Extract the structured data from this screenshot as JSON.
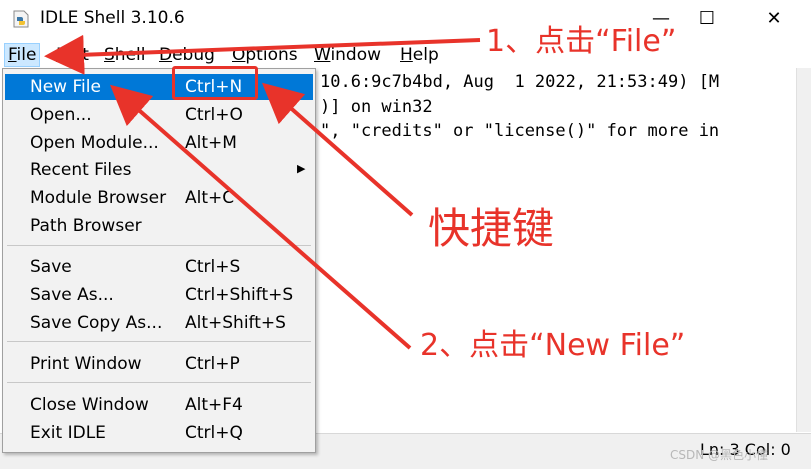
{
  "window": {
    "title": "IDLE Shell 3.10.6",
    "icon": "python-icon",
    "controls": {
      "minimize": "—",
      "maximize": "☐",
      "close": "✕"
    }
  },
  "menubar": {
    "items": [
      {
        "id": "file",
        "label": "File",
        "underline": "F",
        "rest": "ile"
      },
      {
        "id": "edit",
        "label": "Edit",
        "underline": "E",
        "rest": "dit"
      },
      {
        "id": "shell",
        "label": "Shell",
        "underline": "S",
        "rest": "hell"
      },
      {
        "id": "debug",
        "label": "Debug",
        "underline": "D",
        "rest": "ebug"
      },
      {
        "id": "options",
        "label": "Options",
        "underline": "O",
        "rest": "ptions"
      },
      {
        "id": "window",
        "label": "Window",
        "underline": "W",
        "rest": "indow"
      },
      {
        "id": "help",
        "label": "Help",
        "underline": "H",
        "rest": "elp"
      }
    ]
  },
  "shell": {
    "lines": [
      "10.6:9c7b4bd, Aug  1 2022, 21:53:49) [M",
      ")] on win32",
      "\", \"credits\" or \"license()\" for more in"
    ]
  },
  "file_menu": {
    "items": [
      {
        "label": "New File",
        "accel": "Ctrl+N",
        "active": true
      },
      {
        "label": "Open...",
        "accel": "Ctrl+O"
      },
      {
        "label": "Open Module...",
        "accel": "Alt+M"
      },
      {
        "label": "Recent Files",
        "accel": "",
        "submenu": true
      },
      {
        "label": "Module Browser",
        "accel": "Alt+C"
      },
      {
        "label": "Path Browser",
        "accel": ""
      },
      {
        "label": "Save",
        "accel": "Ctrl+S"
      },
      {
        "label": "Save As...",
        "accel": "Ctrl+Shift+S"
      },
      {
        "label": "Save Copy As...",
        "accel": "Alt+Shift+S"
      },
      {
        "label": "Print Window",
        "accel": "Ctrl+P"
      },
      {
        "label": "Close Window",
        "accel": "Alt+F4"
      },
      {
        "label": "Exit IDLE",
        "accel": "Ctrl+Q"
      }
    ]
  },
  "status": {
    "position": "Ln: 3  Col: 0"
  },
  "watermark": "CSDN @黑色小懂",
  "annotations": {
    "step1": "1、点击“File”",
    "shortcut": "快捷键",
    "step2": "2、点击“New File”",
    "color": "#e8332a"
  },
  "colors": {
    "highlight": "#0078d7",
    "menu_bg": "#f2f2f2",
    "file_hover": "#cce8ff"
  }
}
